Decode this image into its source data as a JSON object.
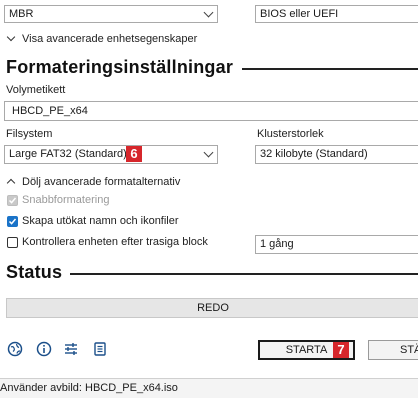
{
  "top": {
    "partition_scheme": "MBR",
    "target_system": "BIOS eller UEFI",
    "show_advanced_device": "Visa avancerade enhetsegenskaper"
  },
  "format": {
    "title": "Formateringsinställningar",
    "volume_label_caption": "Volymetikett",
    "volume_label_value": "HBCD_PE_x64",
    "filesystem_caption": "Filsystem",
    "filesystem_value": "Large FAT32 (Standard)",
    "filesystem_badge": "6",
    "cluster_caption": "Klusterstorlek",
    "cluster_value": "32 kilobyte (Standard)",
    "hide_advanced": "Dölj avancerade formatalternativ",
    "quick_format": "Snabbformatering",
    "extended_label": "Skapa utökat namn och ikonfiler",
    "check_bad_blocks": "Kontrollera enheten efter trasiga block",
    "passes_value": "1 gång"
  },
  "status": {
    "title": "Status",
    "progress_text": "REDO"
  },
  "actions": {
    "start_label": "STARTA",
    "start_badge": "7",
    "close_label": "STÄ"
  },
  "footer": {
    "text": "Använder avbild: HBCD_PE_x64.iso"
  },
  "icons": [
    "globe-icon",
    "info-icon",
    "settings-sliders-icon",
    "log-icon"
  ],
  "colors": {
    "accent": "#1a73c8",
    "badge": "#d6262b"
  }
}
